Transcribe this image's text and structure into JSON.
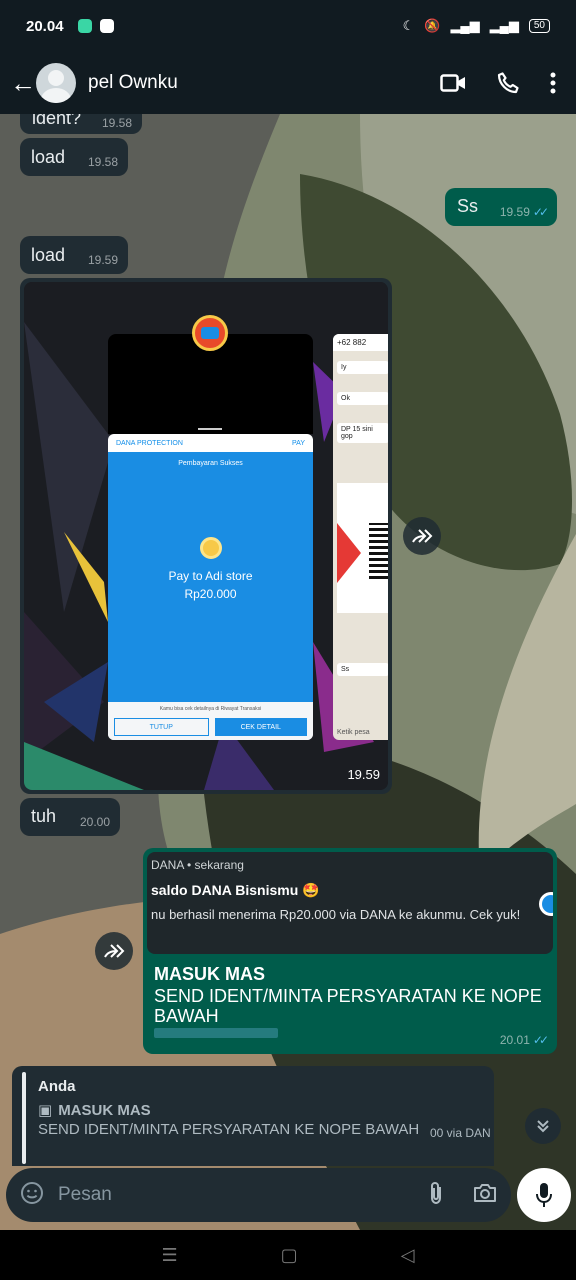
{
  "status_bar": {
    "time": "20.04",
    "battery": "50"
  },
  "header": {
    "contact_name": "pel Ownku"
  },
  "messages": {
    "m0": {
      "text": "ident?",
      "time": "19.58"
    },
    "m1": {
      "text": "load",
      "time": "19.58"
    },
    "m2": {
      "text": "Ss",
      "time": "19.59"
    },
    "m3": {
      "text": "load",
      "time": "19.59"
    },
    "image": {
      "time": "19.59",
      "dana_title": "Pembayaran Sukses",
      "dana_header_left": "DANA PROTECTION",
      "dana_header_right": "PAY",
      "pay_to": "Pay to Adi store",
      "amount": "Rp20.000",
      "hint": "Kamu bisa cek detailnya di Riwayat Transaksi",
      "btn_close": "TUTUP",
      "btn_detail": "CEK DETAIL",
      "wa_header": "+62 882",
      "wa_msgs": [
        "Iy",
        "Ok",
        "DP 15 sini gop",
        "Ss"
      ],
      "wa_input": "Ketik pesa"
    },
    "m4": {
      "text": "tuh",
      "time": "20.00"
    },
    "m5": {
      "notif_source": "DANA • sekarang",
      "notif_title": "saldo DANA Bisnismu 🤩",
      "notif_body": "nu berhasil menerima Rp20.000 via DANA ke akunmu. Cek yuk!",
      "headline": "MASUK MAS",
      "body": "SEND IDENT/MINTA PERSYARATAN KE NOPE BAWAH",
      "time": "20.01"
    }
  },
  "reply_preview": {
    "author": "Anda",
    "quoted_title": "MASUK MAS",
    "quoted_body": "SEND IDENT/MINTA PERSYARATAN KE NOPE BAWAH",
    "quoted_tail": "00 via DAN"
  },
  "input": {
    "placeholder": "Pesan"
  },
  "colors": {
    "incoming": "#202c33",
    "outgoing": "#005c4b",
    "header": "#111b21",
    "read_ticks": "#53bdeb"
  }
}
